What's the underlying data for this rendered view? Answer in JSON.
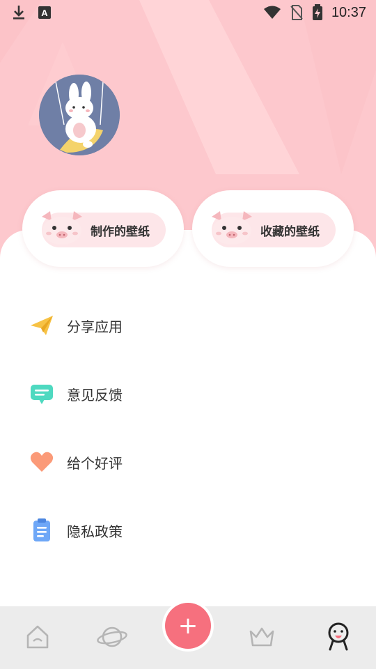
{
  "status_bar": {
    "time": "10:37",
    "left_icons": [
      "download-icon",
      "font-a-icon"
    ],
    "right_icons": [
      "wifi-icon",
      "no-sim-icon",
      "battery-charging-icon"
    ]
  },
  "profile": {
    "avatar_icon": "bunny-avatar-icon"
  },
  "quick_actions": [
    {
      "label": "制作的壁纸",
      "icon": "pig-icon"
    },
    {
      "label": "收藏的壁纸",
      "icon": "pig-icon"
    }
  ],
  "menu": [
    {
      "label": "分享应用",
      "icon": "paper-plane-icon"
    },
    {
      "label": "意见反馈",
      "icon": "chat-bubble-icon"
    },
    {
      "label": "给个好评",
      "icon": "heart-icon"
    },
    {
      "label": "隐私政策",
      "icon": "clipboard-icon"
    }
  ],
  "bottom_nav": {
    "items": [
      "home-icon",
      "planet-icon",
      "add-button",
      "crown-icon",
      "profile-icon"
    ],
    "fab_symbol": "+"
  },
  "colors": {
    "header_pink": "#fdc8cd",
    "accent": "#f6707e",
    "pill_pink": "#fde6e9"
  }
}
